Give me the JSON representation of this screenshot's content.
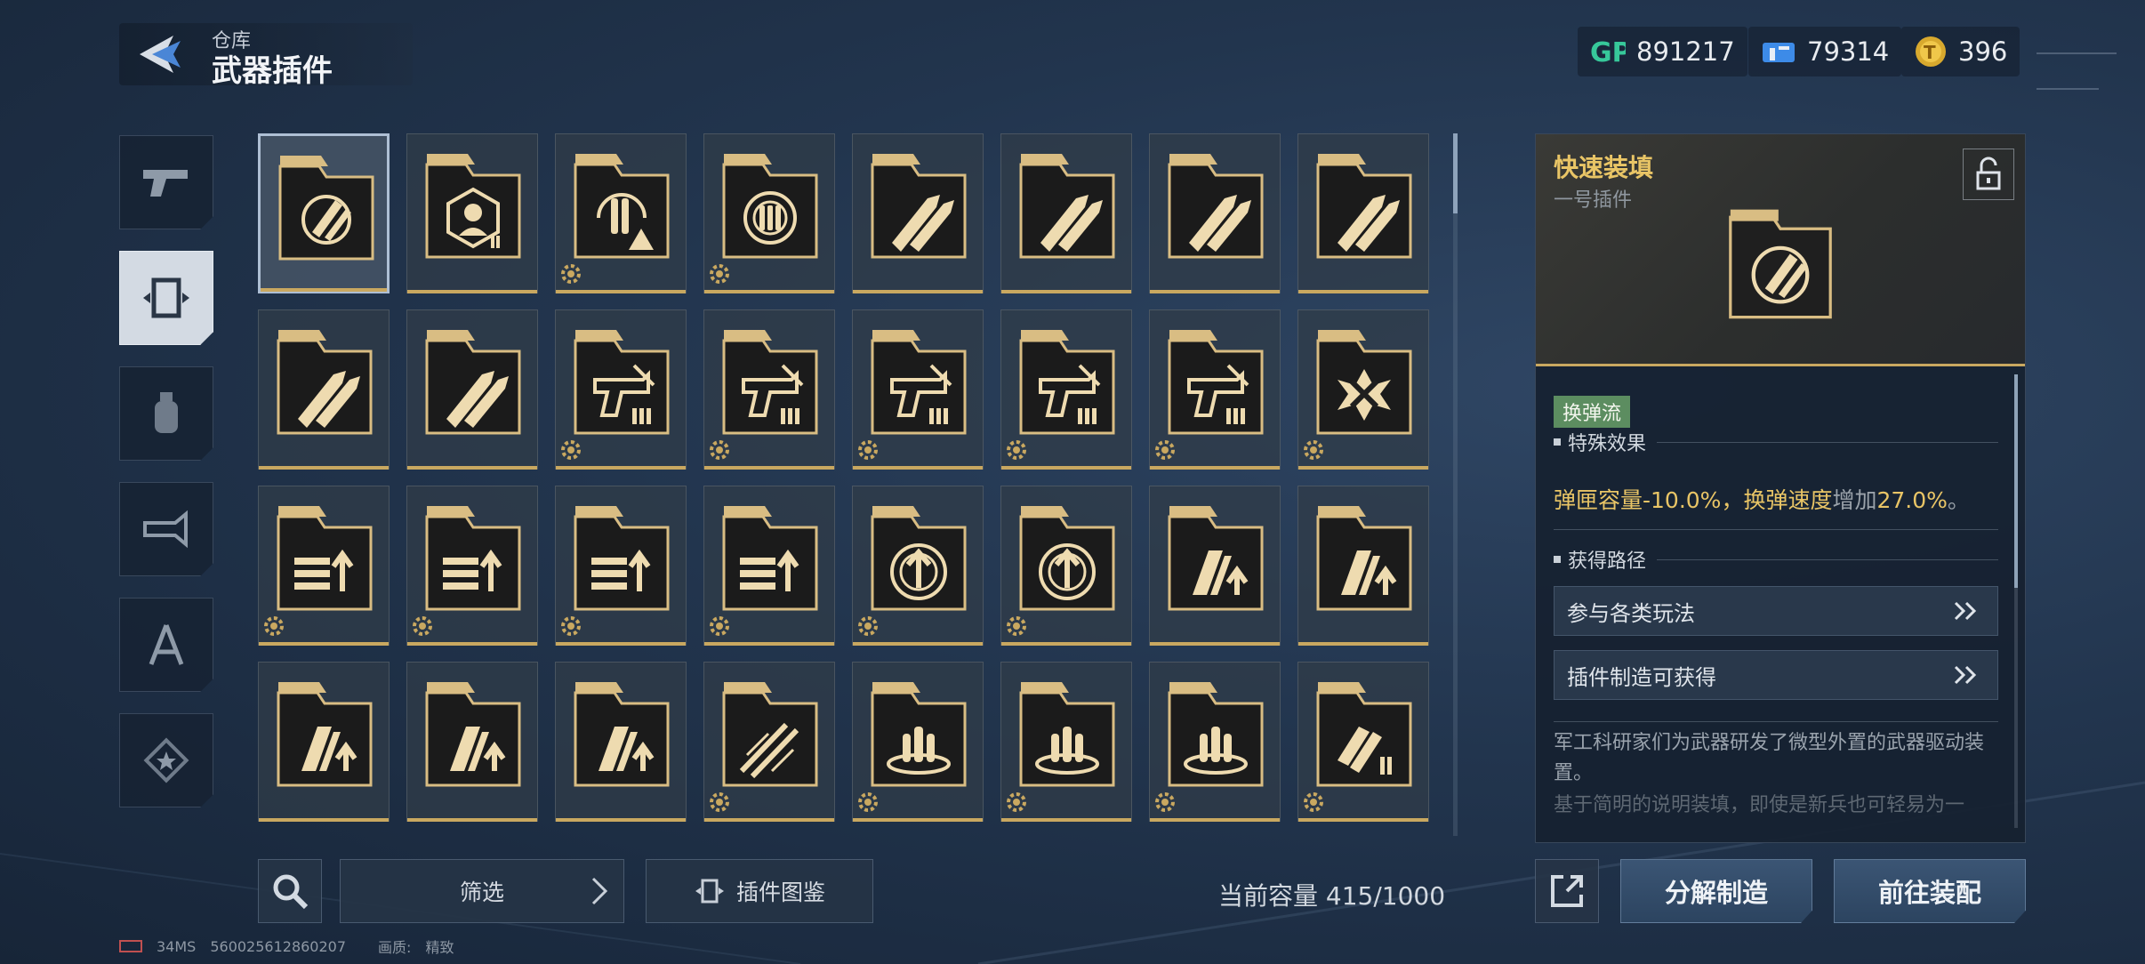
{
  "header": {
    "breadcrumb": "仓库",
    "title": "武器插件"
  },
  "currencies": [
    {
      "icon": "gp-icon",
      "value": "891217"
    },
    {
      "icon": "ticket-icon",
      "value": "79314"
    },
    {
      "icon": "gold-coin-icon",
      "value": "396"
    }
  ],
  "side_tabs": [
    {
      "icon": "pistol-icon",
      "active": false
    },
    {
      "icon": "plugin-chip-icon",
      "active": true
    },
    {
      "icon": "grenade-icon",
      "active": false
    },
    {
      "icon": "gadget-icon",
      "active": false
    },
    {
      "icon": "compass-icon",
      "active": false
    },
    {
      "icon": "star-badge-icon",
      "active": false
    }
  ],
  "grid": {
    "items": [
      {
        "icon": "bullet-reload-icon",
        "gear": false,
        "selected": true
      },
      {
        "icon": "target-person-icon",
        "gear": false
      },
      {
        "icon": "bullet-warning-icon",
        "gear": true
      },
      {
        "icon": "crosshair-bullets-icon",
        "gear": true
      },
      {
        "icon": "twin-bullets-icon",
        "gear": false
      },
      {
        "icon": "twin-bullets-icon",
        "gear": false
      },
      {
        "icon": "twin-bullets-icon",
        "gear": false
      },
      {
        "icon": "twin-bullets-icon",
        "gear": false
      },
      {
        "icon": "twin-bullets-icon",
        "gear": false
      },
      {
        "icon": "twin-bullets-icon",
        "gear": false
      },
      {
        "icon": "gun-ammo-icon",
        "gear": true
      },
      {
        "icon": "gun-ammo-icon",
        "gear": true
      },
      {
        "icon": "gun-ammo-icon",
        "gear": true
      },
      {
        "icon": "gun-ammo-icon",
        "gear": true
      },
      {
        "icon": "gun-ammo-icon",
        "gear": true
      },
      {
        "icon": "burst-x-icon",
        "gear": true
      },
      {
        "icon": "ammo-up-icon",
        "gear": true
      },
      {
        "icon": "ammo-up-icon",
        "gear": true
      },
      {
        "icon": "ammo-up-icon",
        "gear": true
      },
      {
        "icon": "ammo-up-icon",
        "gear": true
      },
      {
        "icon": "crosshair-up-icon",
        "gear": true
      },
      {
        "icon": "crosshair-up-icon",
        "gear": true
      },
      {
        "icon": "magazine-up-icon",
        "gear": false
      },
      {
        "icon": "magazine-up-icon",
        "gear": false
      },
      {
        "icon": "magazine-up-icon",
        "gear": false
      },
      {
        "icon": "magazine-up-icon",
        "gear": false
      },
      {
        "icon": "magazine-up-icon",
        "gear": false
      },
      {
        "icon": "bullet-streak-icon",
        "gear": true
      },
      {
        "icon": "bullets-ring-icon",
        "gear": true
      },
      {
        "icon": "bullets-ring-icon",
        "gear": true
      },
      {
        "icon": "bullets-ring-icon",
        "gear": true
      },
      {
        "icon": "magazine-ammo-icon",
        "gear": true
      }
    ]
  },
  "bottom": {
    "filter_label": "筛选",
    "codex_label": "插件图鉴",
    "capacity": "当前容量 415/1000"
  },
  "detail": {
    "name": "快速装填",
    "subtitle": "一号插件",
    "tag": "换弹流",
    "effect_title": "特殊效果",
    "effect_part1": "弹匣容量-10.0%，换弹速度",
    "effect_part2": "增加",
    "effect_part3": "27.0%",
    "effect_part4": "。",
    "source_title": "获得路径",
    "sources": [
      "参与各类玩法",
      "插件制造可获得"
    ],
    "description": "军工科研家们为武器研发了微型外置的武器驱动装置。",
    "description_faded": "基于简明的说明装填，即使是新兵也可轻易为一"
  },
  "actions": {
    "dismantle": "分解制造",
    "equip": "前往装配"
  },
  "status_bar": {
    "ping": "34MS",
    "uid": "560025612860207",
    "quality_label": "画质:",
    "quality_value": "精致"
  },
  "colors": {
    "accent_gold": "#c9a860",
    "title_gold": "#e9c566",
    "tag_green": "#5c8d60"
  }
}
